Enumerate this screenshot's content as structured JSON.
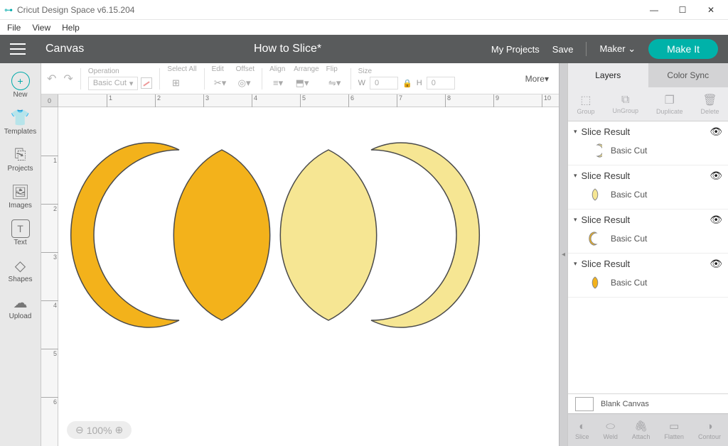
{
  "app": {
    "title": "Cricut Design Space  v6.15.204"
  },
  "menu": [
    "File",
    "View",
    "Help"
  ],
  "header": {
    "canvas": "Canvas",
    "project": "How to Slice*",
    "myprojects": "My Projects",
    "save": "Save",
    "machine": "Maker",
    "makeit": "Make It"
  },
  "leftnav": [
    {
      "id": "new",
      "label": "New",
      "icon": "+"
    },
    {
      "id": "templates",
      "label": "Templates",
      "icon": "👕"
    },
    {
      "id": "projects",
      "label": "Projects",
      "icon": "⎘"
    },
    {
      "id": "images",
      "label": "Images",
      "icon": "🖼"
    },
    {
      "id": "text",
      "label": "Text",
      "icon": "T"
    },
    {
      "id": "shapes",
      "label": "Shapes",
      "icon": "◇"
    },
    {
      "id": "upload",
      "label": "Upload",
      "icon": "☁"
    }
  ],
  "toolbar": {
    "operation_label": "Operation",
    "operation_value": "Basic Cut",
    "selectall": "Select All",
    "edit": "Edit",
    "offset": "Offset",
    "align": "Align",
    "arrange": "Arrange",
    "flip": "Flip",
    "size": "Size",
    "w": "W",
    "h": "H",
    "wval": "0",
    "hval": "0",
    "more": "More"
  },
  "ruler": {
    "corner": "0",
    "xlabels": [
      "1",
      "2",
      "3",
      "4",
      "5",
      "6",
      "7",
      "8",
      "9",
      "10"
    ],
    "ylabels": [
      "1",
      "2",
      "3",
      "4",
      "5",
      "6"
    ]
  },
  "zoom": "100%",
  "tabs": {
    "layers": "Layers",
    "colorsync": "Color Sync"
  },
  "layerops": [
    "Group",
    "UnGroup",
    "Duplicate",
    "Delete"
  ],
  "layers": [
    {
      "name": "Slice Result",
      "sub": "Basic Cut",
      "shape": "crescent-right",
      "fill": "#f6e27a"
    },
    {
      "name": "Slice Result",
      "sub": "Basic Cut",
      "shape": "lens",
      "fill": "#f6e27a"
    },
    {
      "name": "Slice Result",
      "sub": "Basic Cut",
      "shape": "crescent-left",
      "fill": "#f3b21b"
    },
    {
      "name": "Slice Result",
      "sub": "Basic Cut",
      "shape": "lens",
      "fill": "#f3b21b"
    }
  ],
  "mat": "Blank Canvas",
  "bottomtools": [
    "Slice",
    "Weld",
    "Attach",
    "Flatten",
    "Contour"
  ]
}
